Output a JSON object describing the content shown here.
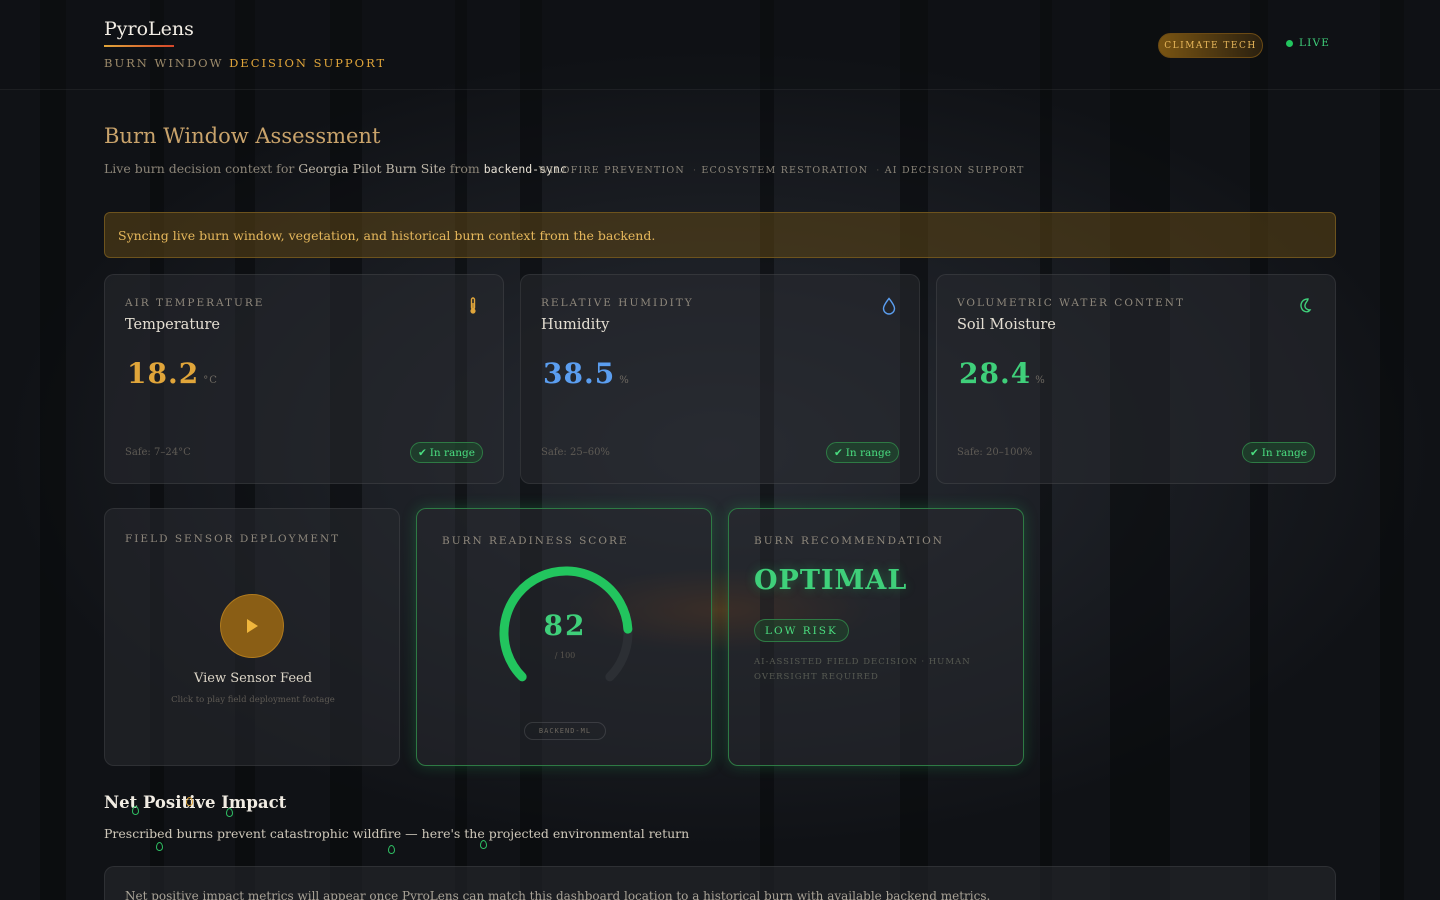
{
  "brand": {
    "name": "PyroLens",
    "tagline_dim": "BURN WINDOW ",
    "tagline_hl": "DECISION SUPPORT"
  },
  "header": {
    "badge": "CLIMATE TECH",
    "live": "LIVE"
  },
  "page": {
    "title": "Burn Window Assessment",
    "sub_prefix": "Live burn decision context for ",
    "site": "Georgia Pilot Burn Site",
    "sub_mid": " from ",
    "source": "backend-sync",
    "tags": [
      "WILDFIRE PREVENTION",
      "ECOSYSTEM RESTORATION",
      "AI DECISION SUPPORT"
    ]
  },
  "banner": "Syncing live burn window, vegetation, and historical burn context from the backend.",
  "metrics": [
    {
      "kicker": "AIR TEMPERATURE",
      "name": "Temperature",
      "value": "18.2",
      "unit": "°C",
      "safe": "Safe: 7–24°C",
      "status": "In range",
      "icon": "thermometer-icon",
      "color": "#e0a53a"
    },
    {
      "kicker": "RELATIVE HUMIDITY",
      "name": "Humidity",
      "value": "38.5",
      "unit": "%",
      "safe": "Safe: 25–60%",
      "status": "In range",
      "icon": "droplet-icon",
      "color": "#5b9ef0"
    },
    {
      "kicker": "VOLUMETRIC WATER CONTENT",
      "name": "Soil Moisture",
      "value": "28.4",
      "unit": "%",
      "safe": "Safe: 20–100%",
      "status": "In range",
      "icon": "leaf-icon",
      "color": "#3fcf7a"
    }
  ],
  "sensor": {
    "kicker": "FIELD SENSOR DEPLOYMENT",
    "label": "View Sensor Feed",
    "hint": "Click to play field deployment footage"
  },
  "readiness": {
    "kicker": "BURN READINESS SCORE",
    "score": 82,
    "max": 100,
    "max_label": "/ 100",
    "source": "BACKEND-ML"
  },
  "recommendation": {
    "kicker": "BURN RECOMMENDATION",
    "verdict": "OPTIMAL",
    "risk": "LOW RISK",
    "note": "AI-ASSISTED FIELD DECISION · HUMAN OVERSIGHT REQUIRED"
  },
  "impact": {
    "title": "Net Positive Impact",
    "subtitle": "Prescribed burns prevent catastrophic wildfire — here's the projected environmental return",
    "message": "Net positive impact metrics will appear once PyroLens can match this dashboard location to a historical burn with available backend metrics."
  },
  "colors": {
    "accent": "#e0a53a",
    "good": "#22c55e",
    "info": "#5b9ef0"
  }
}
